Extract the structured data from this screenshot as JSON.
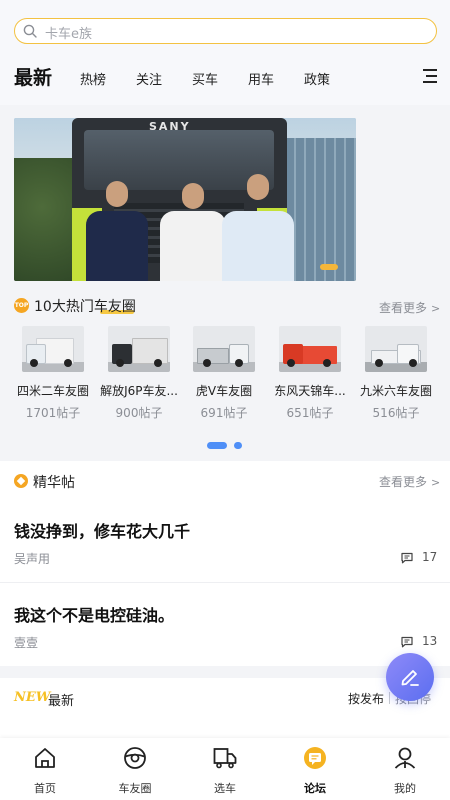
{
  "search": {
    "placeholder": "卡车e族"
  },
  "tabs": [
    {
      "label": "最新",
      "active": true
    },
    {
      "label": "热榜"
    },
    {
      "label": "关注"
    },
    {
      "label": "买车"
    },
    {
      "label": "用车"
    },
    {
      "label": "政策"
    }
  ],
  "banner": {
    "brand_text": "SANY"
  },
  "hot_circles": {
    "badge": "TOP",
    "title": "10大热门车友圈",
    "more_label": "查看更多",
    "items": [
      {
        "name": "四米二车友圈",
        "count": "1701帖子"
      },
      {
        "name": "解放J6P车友...",
        "count": "900帖子"
      },
      {
        "name": "虎V车友圈",
        "count": "691帖子"
      },
      {
        "name": "东风天锦车...",
        "count": "651帖子"
      },
      {
        "name": "九米六车友圈",
        "count": "516帖子"
      }
    ]
  },
  "featured": {
    "title": "精华帖",
    "more_label": "查看更多",
    "posts": [
      {
        "title": "钱没挣到，修车花大几千",
        "author": "吴声用",
        "comments": "17"
      },
      {
        "title": "我这个不是电控硅油。",
        "author": "壹壹",
        "comments": "13"
      }
    ]
  },
  "latest": {
    "new_tag": "NEW",
    "title": "最新",
    "sort_by_publish": "按发布",
    "sort_by_reply": "按回停"
  },
  "bottom_nav": [
    {
      "label": "首页",
      "icon": "home-icon"
    },
    {
      "label": "车友圈",
      "icon": "steering-wheel-icon"
    },
    {
      "label": "选车",
      "icon": "truck-icon"
    },
    {
      "label": "论坛",
      "icon": "forum-icon",
      "active": true
    },
    {
      "label": "我的",
      "icon": "user-icon"
    }
  ],
  "colors": {
    "accent": "#f5b321",
    "search_border": "#f3c242",
    "pager_active": "#4f8ff7",
    "fab": "#6b74f3"
  }
}
